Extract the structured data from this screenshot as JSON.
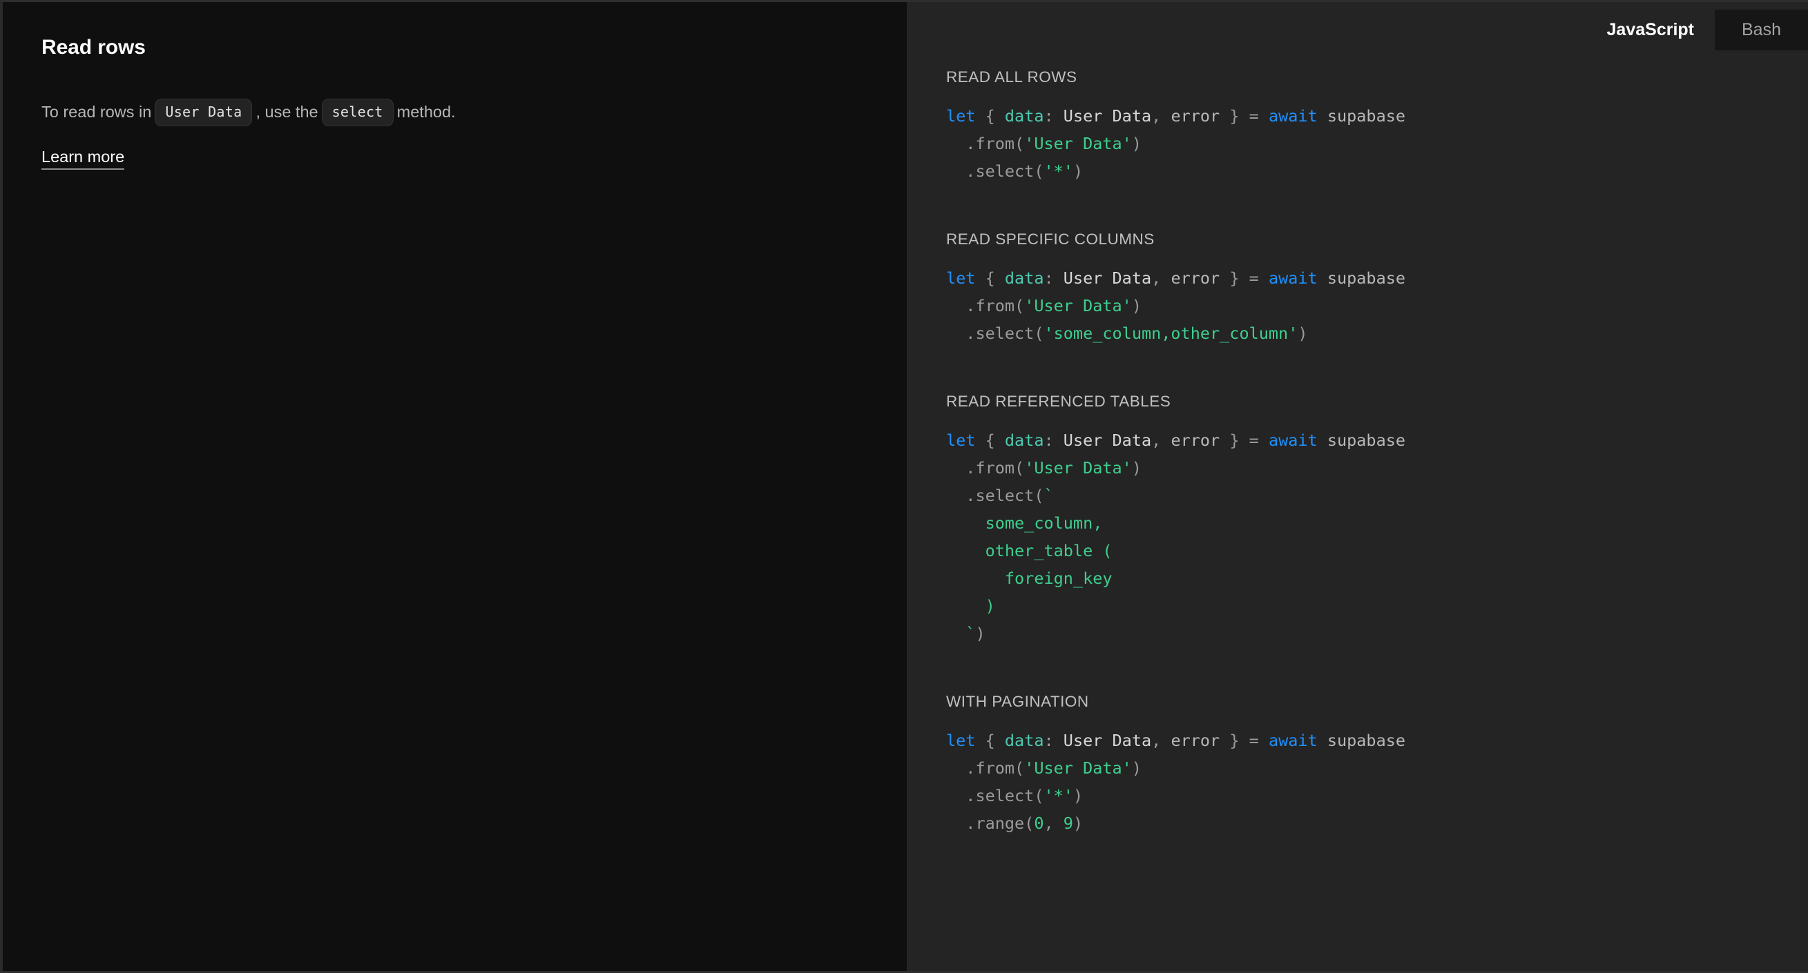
{
  "left": {
    "title": "Read rows",
    "description": {
      "before": "To read rows in",
      "code_table": "User Data",
      "middle": ", use the",
      "code_method": "select",
      "after": "method."
    },
    "learn_more_label": "Learn more"
  },
  "tabs": [
    {
      "label": "JavaScript",
      "active": true
    },
    {
      "label": "Bash",
      "active": false
    }
  ],
  "sections": [
    {
      "label": "READ ALL ROWS",
      "lines": [
        [
          {
            "t": "let",
            "c": "kw"
          },
          {
            "t": " { ",
            "c": "punc"
          },
          {
            "t": "data",
            "c": "prop"
          },
          {
            "t": ": ",
            "c": "punc"
          },
          {
            "t": "User Data",
            "c": "var"
          },
          {
            "t": ", ",
            "c": "punc"
          },
          {
            "t": "error",
            "c": "id"
          },
          {
            "t": " } = ",
            "c": "punc"
          },
          {
            "t": "await",
            "c": "kw"
          },
          {
            "t": " supabase",
            "c": "id"
          }
        ],
        [
          {
            "t": "  .from(",
            "c": "fn"
          },
          {
            "t": "'User Data'",
            "c": "str"
          },
          {
            "t": ")",
            "c": "fn"
          }
        ],
        [
          {
            "t": "  .select(",
            "c": "fn"
          },
          {
            "t": "'*'",
            "c": "str"
          },
          {
            "t": ")",
            "c": "fn"
          }
        ]
      ]
    },
    {
      "label": "READ SPECIFIC COLUMNS",
      "lines": [
        [
          {
            "t": "let",
            "c": "kw"
          },
          {
            "t": " { ",
            "c": "punc"
          },
          {
            "t": "data",
            "c": "prop"
          },
          {
            "t": ": ",
            "c": "punc"
          },
          {
            "t": "User Data",
            "c": "var"
          },
          {
            "t": ", ",
            "c": "punc"
          },
          {
            "t": "error",
            "c": "id"
          },
          {
            "t": " } = ",
            "c": "punc"
          },
          {
            "t": "await",
            "c": "kw"
          },
          {
            "t": " supabase",
            "c": "id"
          }
        ],
        [
          {
            "t": "  .from(",
            "c": "fn"
          },
          {
            "t": "'User Data'",
            "c": "str"
          },
          {
            "t": ")",
            "c": "fn"
          }
        ],
        [
          {
            "t": "  .select(",
            "c": "fn"
          },
          {
            "t": "'some_column,other_column'",
            "c": "str"
          },
          {
            "t": ")",
            "c": "fn"
          }
        ]
      ]
    },
    {
      "label": "READ REFERENCED TABLES",
      "lines": [
        [
          {
            "t": "let",
            "c": "kw"
          },
          {
            "t": " { ",
            "c": "punc"
          },
          {
            "t": "data",
            "c": "prop"
          },
          {
            "t": ": ",
            "c": "punc"
          },
          {
            "t": "User Data",
            "c": "var"
          },
          {
            "t": ", ",
            "c": "punc"
          },
          {
            "t": "error",
            "c": "id"
          },
          {
            "t": " } = ",
            "c": "punc"
          },
          {
            "t": "await",
            "c": "kw"
          },
          {
            "t": " supabase",
            "c": "id"
          }
        ],
        [
          {
            "t": "  .from(",
            "c": "fn"
          },
          {
            "t": "'User Data'",
            "c": "str"
          },
          {
            "t": ")",
            "c": "fn"
          }
        ],
        [
          {
            "t": "  .select(",
            "c": "fn"
          },
          {
            "t": "`",
            "c": "str"
          }
        ],
        [
          {
            "t": "    some_column,",
            "c": "str"
          }
        ],
        [
          {
            "t": "    other_table (",
            "c": "str"
          }
        ],
        [
          {
            "t": "      foreign_key",
            "c": "str"
          }
        ],
        [
          {
            "t": "    )",
            "c": "str"
          }
        ],
        [
          {
            "t": "  `",
            "c": "str"
          },
          {
            "t": ")",
            "c": "fn"
          }
        ]
      ]
    },
    {
      "label": "WITH PAGINATION",
      "lines": [
        [
          {
            "t": "let",
            "c": "kw"
          },
          {
            "t": " { ",
            "c": "punc"
          },
          {
            "t": "data",
            "c": "prop"
          },
          {
            "t": ": ",
            "c": "punc"
          },
          {
            "t": "User Data",
            "c": "var"
          },
          {
            "t": ", ",
            "c": "punc"
          },
          {
            "t": "error",
            "c": "id"
          },
          {
            "t": " } = ",
            "c": "punc"
          },
          {
            "t": "await",
            "c": "kw"
          },
          {
            "t": " supabase",
            "c": "id"
          }
        ],
        [
          {
            "t": "  .from(",
            "c": "fn"
          },
          {
            "t": "'User Data'",
            "c": "str"
          },
          {
            "t": ")",
            "c": "fn"
          }
        ],
        [
          {
            "t": "  .select(",
            "c": "fn"
          },
          {
            "t": "'*'",
            "c": "str"
          },
          {
            "t": ")",
            "c": "fn"
          }
        ],
        [
          {
            "t": "  .range(",
            "c": "fn"
          },
          {
            "t": "0",
            "c": "num"
          },
          {
            "t": ", ",
            "c": "fn"
          },
          {
            "t": "9",
            "c": "num"
          },
          {
            "t": ")",
            "c": "fn"
          }
        ]
      ]
    }
  ],
  "colors": {
    "left_bg": "#0f0f0f",
    "right_bg": "#242424",
    "keyword": "#1e90ff",
    "string": "#3ecf8e",
    "property": "#4ec9b0",
    "inactive_tab_bg": "#161616"
  }
}
